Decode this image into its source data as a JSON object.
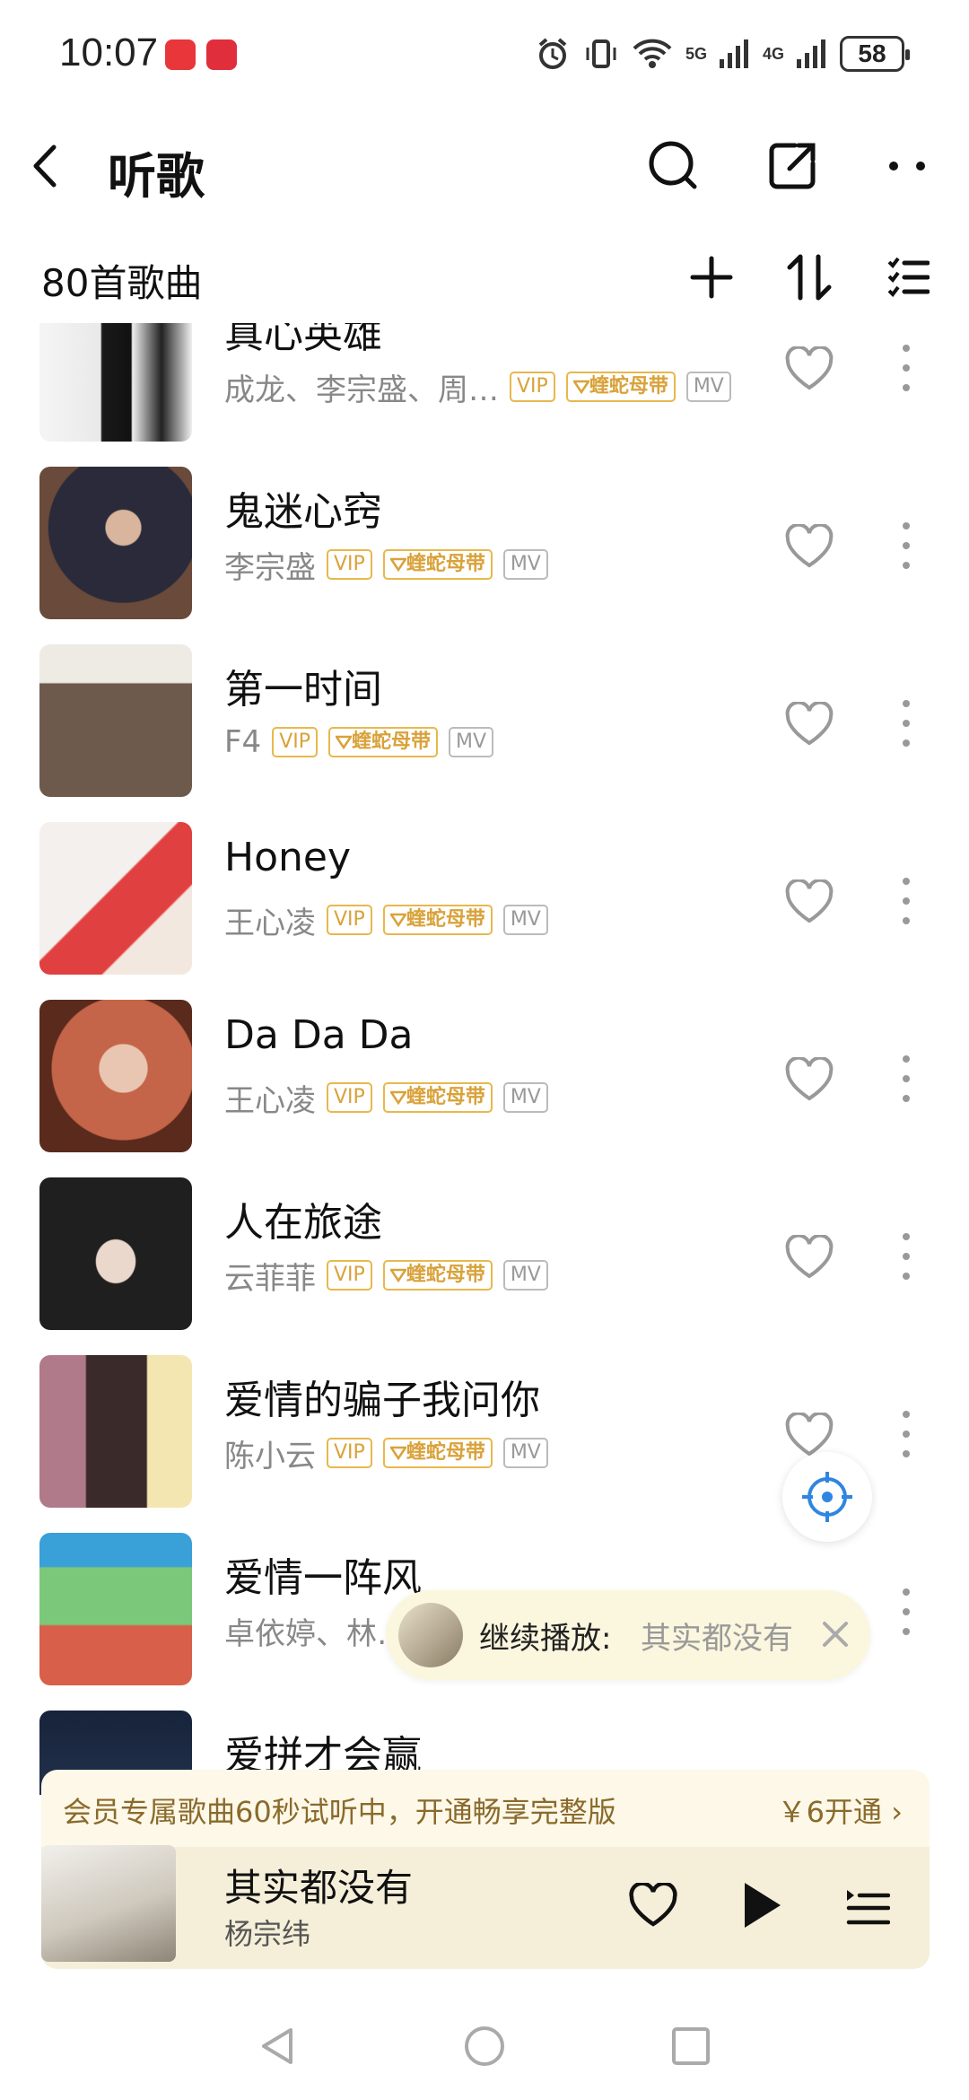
{
  "status": {
    "time": "10:07",
    "network_5g": "5G",
    "network_4g": "4G",
    "battery": "58"
  },
  "header": {
    "title": "听歌",
    "icons": [
      "back-icon",
      "search-icon",
      "share-icon",
      "more-icon"
    ]
  },
  "subheader": {
    "count_label": "80首歌曲",
    "icons": [
      "add-icon",
      "sort-icon",
      "multi-select-icon"
    ]
  },
  "badges": {
    "vip": "VIP",
    "band": "蝰蛇母带",
    "mv": "MV"
  },
  "songs": [
    {
      "title": "真心英雄",
      "artist": "成龙、李宗盛、周…"
    },
    {
      "title": "鬼迷心窍",
      "artist": "李宗盛"
    },
    {
      "title": "第一时间",
      "artist": "F4"
    },
    {
      "title": "Honey",
      "artist": "王心凌"
    },
    {
      "title": "Da Da Da",
      "artist": "王心凌"
    },
    {
      "title": "人在旅途",
      "artist": "云菲菲"
    },
    {
      "title": "爱情的骗子我问你",
      "artist": "陈小云"
    },
    {
      "title": "爱情一阵风",
      "artist": "卓依婷、林…"
    },
    {
      "title": "爱拼才会赢",
      "artist": ""
    }
  ],
  "resume_toast": {
    "label": "继续播放:",
    "song": "其实都没有"
  },
  "vip_bar": {
    "text": "会员专属歌曲60秒试听中，开通畅享完整版",
    "button": "￥6开通 ›"
  },
  "player": {
    "title": "其实都没有",
    "artist": "杨宗纬"
  },
  "colors": {
    "accent_gold": "#d9a23a",
    "player_bg": "#f5efd9",
    "vip_bg": "#fdf8e8"
  }
}
